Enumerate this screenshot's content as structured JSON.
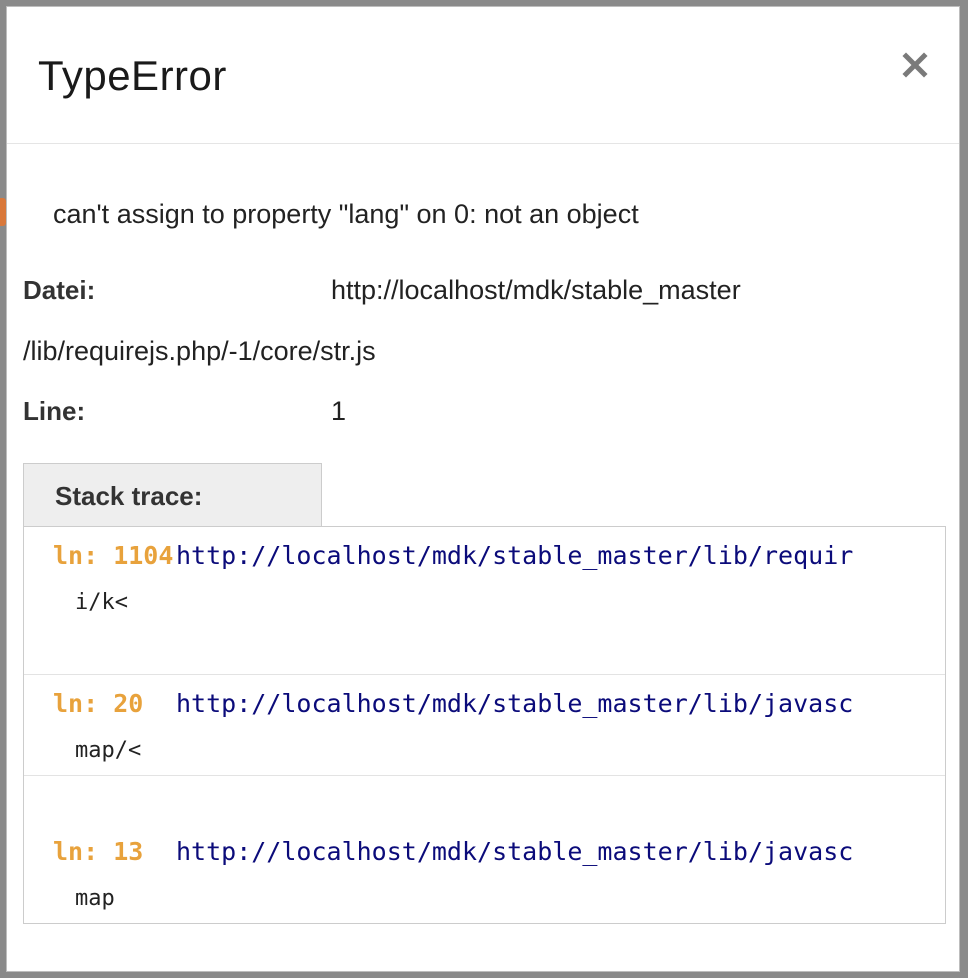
{
  "error": {
    "title": "TypeError",
    "message": "can't assign to property \"lang\" on 0: not an object",
    "close_icon": "close-icon"
  },
  "details": {
    "file_label": "Datei:",
    "file_value_line1": "http://localhost/mdk/stable_master",
    "file_value_line2": "/lib/requirejs.php/-1/core/str.js",
    "line_label": "Line:",
    "line_value": "1"
  },
  "stack": {
    "tab_label": "Stack trace:",
    "frames": [
      {
        "ln": "ln: 1104",
        "url": "http://localhost/mdk/stable_master/lib/requir",
        "func": "i/k<"
      },
      {
        "ln": "ln: 20",
        "url": "http://localhost/mdk/stable_master/lib/javasc",
        "func": "map/<"
      },
      {
        "ln": "ln: 13",
        "url": "http://localhost/mdk/stable_master/lib/javasc",
        "func": "map"
      }
    ]
  },
  "colors": {
    "line_number": "#e8a23c",
    "url": "#0b0b7a",
    "tab_background": "#eeeeee"
  }
}
